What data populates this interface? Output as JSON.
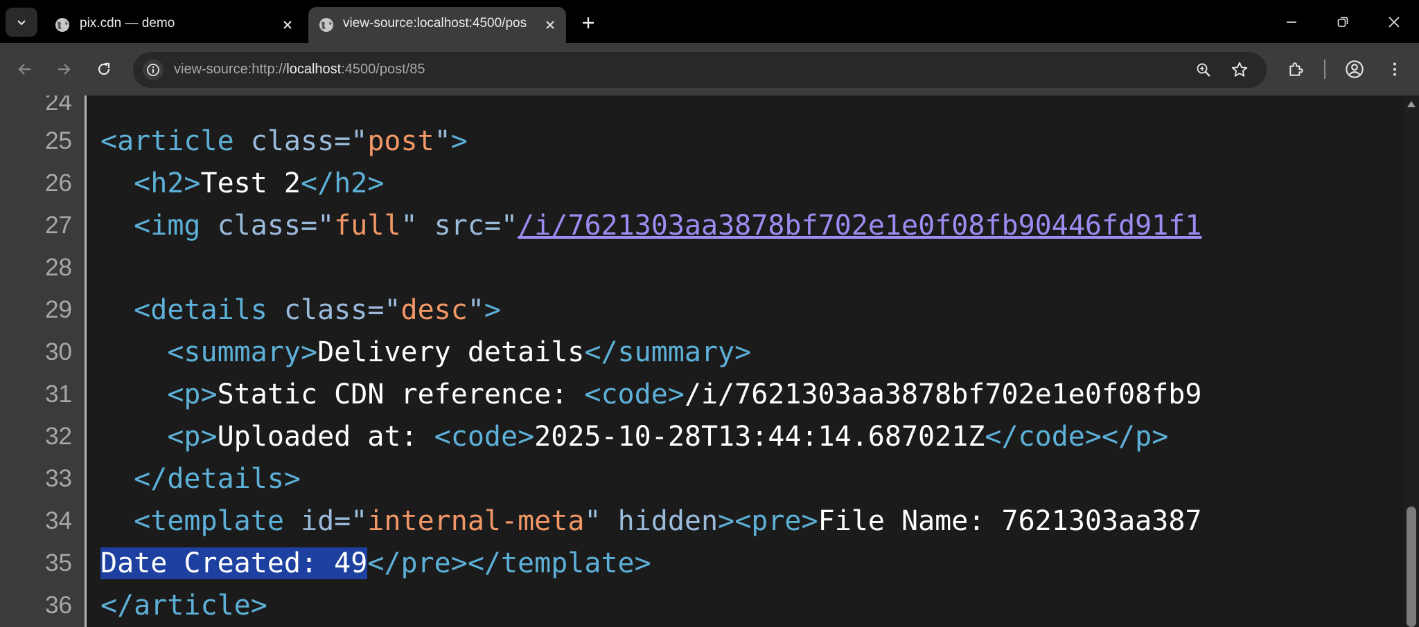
{
  "tabs": [
    {
      "title": "pix.cdn — demo",
      "active": false
    },
    {
      "title": "view-source:localhost:4500/pos",
      "active": true
    }
  ],
  "toolbar": {
    "url_prefix": "view-source:http://",
    "url_host": "localhost",
    "url_rest": ":4500/post/85"
  },
  "icons": [
    "tab-search-icon",
    "globe-icon",
    "close-icon",
    "plus-icon",
    "minimize-icon",
    "restore-icon",
    "window-close-icon",
    "back-icon",
    "forward-icon",
    "reload-icon",
    "site-info-icon",
    "zoom-icon",
    "star-icon",
    "extensions-icon",
    "profile-icon",
    "menu-icon"
  ],
  "colors": {
    "tag": "#5db0d7",
    "attr": "#9bbbdc",
    "value": "#f29766",
    "link": "#9b8cf2",
    "selection": "#1e40a0"
  },
  "source": {
    "line_numbers": [
      "24",
      "25",
      "26",
      "27",
      "28",
      "29",
      "30",
      "31",
      "32",
      "33",
      "34",
      "35",
      "36"
    ],
    "l25": {
      "open": "<article",
      "attr": " class=",
      "q1": "\"",
      "val": "post",
      "q2": "\"",
      "close": ">"
    },
    "l26": {
      "open": "<h2>",
      "text": "Test 2",
      "close": "</h2>"
    },
    "l27": {
      "open": "<img",
      "attr1": " class=",
      "q1": "\"",
      "val1": "full",
      "q2": "\"",
      "attr2": " src=",
      "q3": "\"",
      "link": "/i/7621303aa3878bf702e1e0f08fb90446fd91f1"
    },
    "l29": {
      "open": "<details",
      "attr": " class=",
      "q1": "\"",
      "val": "desc",
      "q2": "\"",
      "close": ">"
    },
    "l30": {
      "open": "<summary>",
      "text": "Delivery details",
      "close": "</summary>"
    },
    "l31": {
      "open": "<p>",
      "text": "Static CDN reference: ",
      "code_open": "<code>",
      "code_text": "/i/7621303aa3878bf702e1e0f08fb9"
    },
    "l32": {
      "open": "<p>",
      "text": "Uploaded at: ",
      "code_open": "<code>",
      "code_text": "2025-10-28T13:44:14.687021Z",
      "code_close": "</code>",
      "close": "</p>"
    },
    "l33": {
      "close": "</details>"
    },
    "l34": {
      "open": "<template",
      "attr1": " id=",
      "q1": "\"",
      "val": "internal-meta",
      "q2": "\"",
      "attr2": " hidden",
      "close": ">",
      "pre_open": "<pre>",
      "text": "File Name: 7621303aa387"
    },
    "l35": {
      "selected": "Date Created: 49",
      "pre_close": "</pre>",
      "close": "</template>"
    },
    "l36": {
      "close": "</article>"
    }
  }
}
